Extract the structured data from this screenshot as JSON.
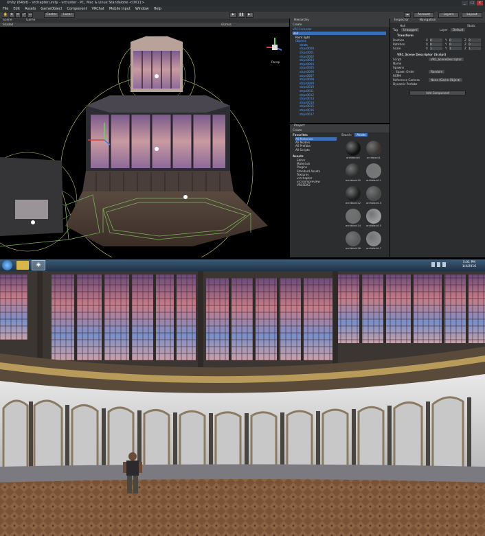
{
  "window": {
    "title": "Unity (64bit) - vrchapter.unity - vrcluster - PC, Mac & Linux Standalone <DX11>",
    "min": "_",
    "max": "□",
    "close": "x"
  },
  "menu": [
    "File",
    "Edit",
    "Assets",
    "GameObject",
    "Component",
    "VRChat",
    "Mobile Input",
    "Window",
    "Help"
  ],
  "toolbar": {
    "center_label": "Center",
    "local_label": "Local",
    "account_label": "Account",
    "layers_label": "Layers",
    "layout_label": "Layout"
  },
  "scene_view": {
    "tab_scene": "Scene",
    "tab_game": "Game",
    "shaded_label": "Shaded",
    "gizmos_label": "Gizmos",
    "persp_label": "Persp"
  },
  "hierarchy": {
    "tab": "Hierarchy",
    "create_label": "Create",
    "root": "VRCCscluster",
    "items": [
      "Hall",
      "Point light",
      "Objects",
      "strats",
      "strps0000",
      "strps0001",
      "strps0002",
      "strps0003",
      "strps0004",
      "strps0005",
      "strps0006",
      "strps0007",
      "strps0008",
      "strps0009",
      "strps0010",
      "strps0011",
      "strps0012",
      "strps0013",
      "strps0014",
      "strps0015",
      "strps0016",
      "strps0017"
    ]
  },
  "project": {
    "tab": "Project",
    "create_label": "Create",
    "search_label": "Search:",
    "assets_filter": "Assets",
    "favorites_header": "Favorites",
    "favorites": [
      "All Materials",
      "All Models",
      "All Prefabs",
      "All Scripts"
    ],
    "assets_header": "Assets",
    "folders": [
      "Editor",
      "Materials",
      "Plugins",
      "Standard Assets",
      "Textures",
      "vrcchapter",
      "vrcroompreview",
      "VRCSDK2"
    ],
    "materials": [
      {
        "name": "archblack0",
        "color": "#111111"
      },
      {
        "name": "archblack1",
        "color": "#3a3432"
      },
      {
        "name": "archblack10",
        "color": "#2b2b2b"
      },
      {
        "name": "archblack11",
        "color": "#777777"
      },
      {
        "name": "archblack12",
        "color": "#1e1e1e"
      },
      {
        "name": "archblack13",
        "color": "#4a4a4a"
      },
      {
        "name": "archblack14",
        "color": "#6c6c6c"
      },
      {
        "name": "archblack15",
        "color": "#9a9a9a"
      },
      {
        "name": "archblack16",
        "color": "#5a5a5a"
      },
      {
        "name": "archblack17",
        "color": "#8a8a8a"
      }
    ]
  },
  "inspector": {
    "tab": "Inspector",
    "tab2": "Navigation",
    "object_name": "Hall",
    "static_label": "Static",
    "tag_label": "Tag",
    "tag_value": "Untagged",
    "layer_label": "Layer",
    "layer_value": "Default",
    "transform_header": "Transform",
    "rows": [
      {
        "label": "Position",
        "x": "0",
        "y": "0",
        "z": "0"
      },
      {
        "label": "Rotation",
        "x": "0",
        "y": "0",
        "z": "0"
      },
      {
        "label": "Scale",
        "x": "1",
        "y": "1",
        "z": "1"
      }
    ],
    "script_header": "VRC_Scene Descriptor (Script)",
    "script_label": "Script",
    "script_value": "VRC_SceneDescriptor",
    "name_label": "Name",
    "spawns_label": "Spawns",
    "spawn_order_label": "Spawn Order",
    "spawn_order_value": "Random",
    "rspm_label": "RSPM",
    "ref_camera_label": "Reference Camera",
    "ref_camera_value": "None (Game Object)",
    "dynamic_prefabs_label": "Dynamic Prefabs",
    "add_component": "Add Component"
  },
  "taskbar": {
    "time": "5:01 PM",
    "date": "1/4/2016"
  },
  "colors": {
    "unity_dark": "#2b2d2f",
    "selection_blue": "#3d6fb6",
    "link_blue": "#5aa3ff",
    "gizmo_green": "#7ab35a",
    "gizmo_yellow": "#b7b76a"
  }
}
